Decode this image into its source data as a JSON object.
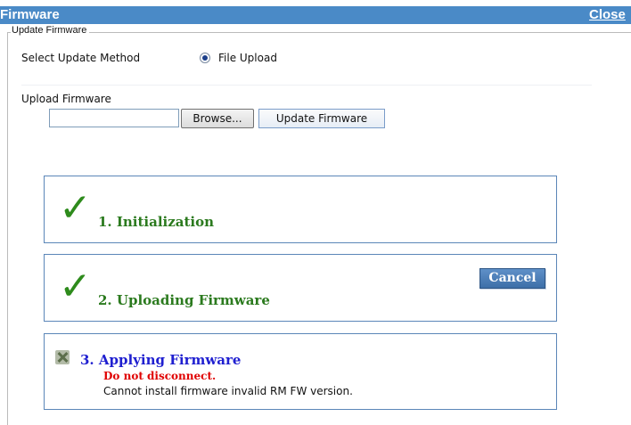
{
  "window": {
    "title": "Firmware",
    "close_label": "Close"
  },
  "update_section": {
    "legend": "Update Firmware",
    "method_label": "Select Update Method",
    "method_option_label": "File Upload",
    "method_option_selected": true,
    "upload_label": "Upload Firmware",
    "file_input_value": "",
    "browse_label": "Browse...",
    "update_button_label": "Update Firmware"
  },
  "steps": [
    {
      "label": "1. Initialization",
      "status": "complete",
      "icon": "checkmark-icon"
    },
    {
      "label": "2. Uploading Firmware",
      "status": "complete",
      "icon": "checkmark-icon",
      "cancel_label": "Cancel"
    },
    {
      "label": "3. Applying Firmware",
      "status": "failed",
      "icon": "error-x-icon",
      "warning": "Do not disconnect.",
      "error_message": "Cannot install firmware invalid RM FW version."
    }
  ],
  "colors": {
    "title_bar": "#4a8ac7",
    "complete": "#2b7a1e",
    "failed_label": "#1f1fd0",
    "warning": "#e00000",
    "step_border": "#5b86b8"
  }
}
